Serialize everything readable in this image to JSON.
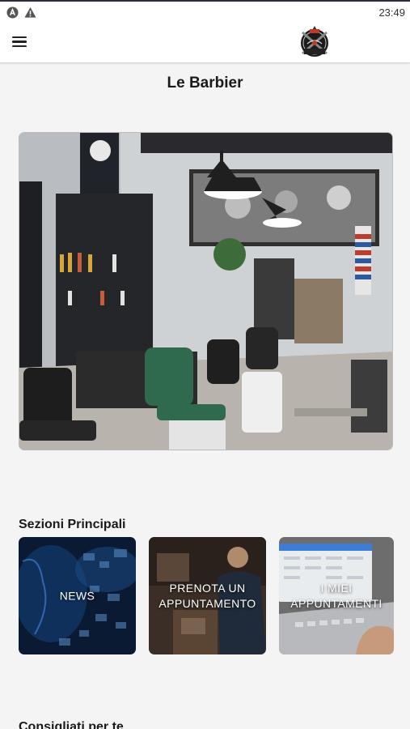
{
  "status_bar": {
    "time": "23:49",
    "icons": [
      "app-notification-icon",
      "warning-icon"
    ]
  },
  "app_bar": {
    "menu_icon": "hamburger-menu-icon",
    "logo": "barber-shop-logo"
  },
  "page": {
    "title": "Le Barbier"
  },
  "main_sections": {
    "title": "Sezioni Principali",
    "cards": [
      {
        "label": "NEWS"
      },
      {
        "label": "PRENOTA UN APPUNTAMENTO"
      },
      {
        "label": "I MIEI APPUNTAMENTI"
      }
    ]
  },
  "recommended": {
    "title": "Consigliati per te"
  }
}
